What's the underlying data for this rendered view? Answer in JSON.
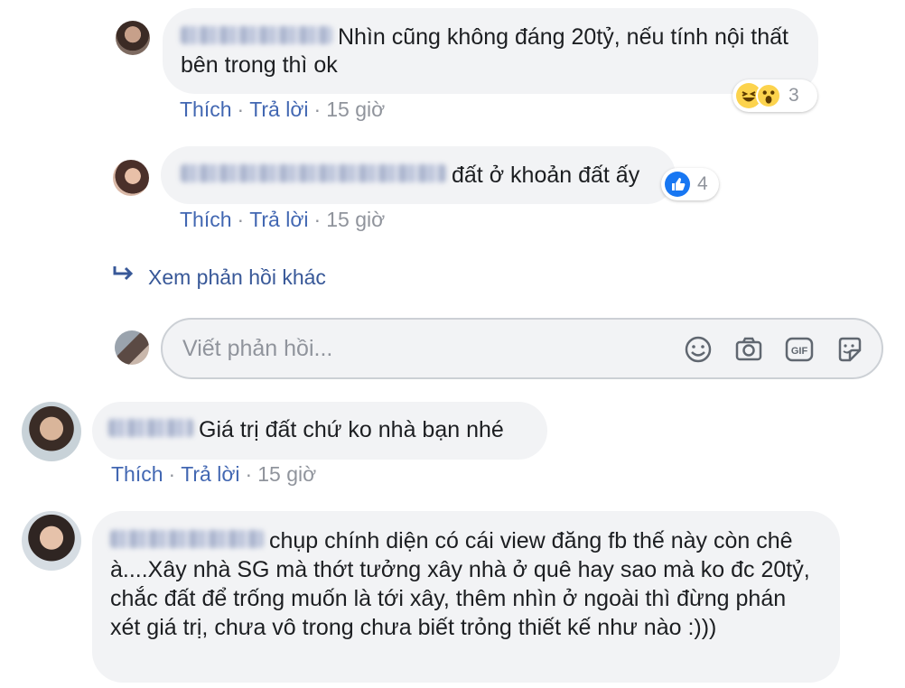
{
  "comments": [
    {
      "text": "Nhìn cũng không đáng 20tỷ, nếu tính nội thất bên trong thì ok",
      "actions": {
        "like": "Thích",
        "reply": "Trả lời",
        "sep": "·",
        "time": "15 giờ"
      },
      "reaction_count": "3",
      "reaction_icons": [
        "laughing-emoji-icon",
        "wow-emoji-icon"
      ]
    },
    {
      "text": "đất ở khoản đất ấy",
      "actions": {
        "like": "Thích",
        "reply": "Trả lời",
        "sep": "·",
        "time": "15 giờ"
      },
      "reaction_count": "4",
      "reaction_icons": [
        "thumbs-up-icon"
      ]
    },
    {
      "text": "Giá trị đất chứ ko nhà bạn nhé",
      "actions": {
        "like": "Thích",
        "reply": "Trả lời",
        "sep": "·",
        "time": "15 giờ"
      }
    },
    {
      "text": "chụp chính diện có cái view đăng fb thế này còn chê à....Xây nhà SG mà thớt tưởng xây nhà ở quê hay sao mà ko đc 20tỷ, chắc đất để trống muốn là tới xây, thêm nhìn ở ngoài thì đừng phán xét giá trị, chưa vô trong chưa biết trỏng thiết kế như nào :)))"
    }
  ],
  "more_replies": {
    "label": "Xem phản hồi khác"
  },
  "composer": {
    "placeholder": "Viết phản hồi...",
    "icons": [
      "emoji-icon",
      "camera-icon",
      "gif-icon",
      "sticker-icon"
    ],
    "gif_label": "GIF"
  },
  "colors": {
    "link": "#4267b2",
    "bubble": "#f2f3f5",
    "meta": "#90949c",
    "like_blue": "#1877f2"
  }
}
